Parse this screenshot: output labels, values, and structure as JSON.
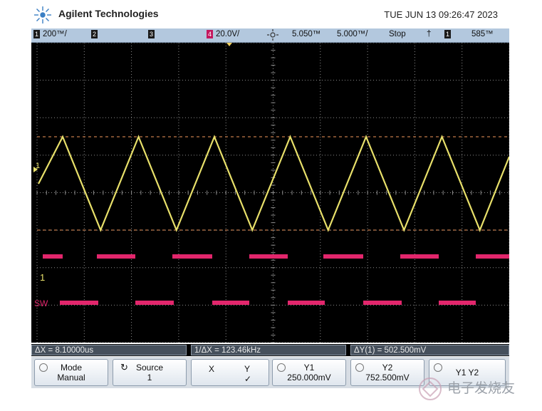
{
  "header": {
    "brand": "Agilent Technologies",
    "datetime": "TUE JUN 13 09:26:47 2023"
  },
  "status_bar": {
    "ch1_num": "1",
    "ch1_scale": "200™/",
    "ch2_num": "2",
    "ch3_num": "3",
    "ch4_num": "4",
    "ch4_scale": "20.0V/",
    "time_offset": "5.050™",
    "time_scale": "5.000™/",
    "run_state": "Stop",
    "trigger_symbol": "†",
    "trigger_ch": "1",
    "trigger_level": "585™"
  },
  "screen": {
    "ch1_label": "1",
    "ch4_label": "1",
    "sw_label": "SW",
    "colors": {
      "ch1": "#e8e06a",
      "ch4": "#e2266c",
      "grid": "#8c8c8c",
      "cursor": "#c47a4a"
    }
  },
  "measurements": {
    "dx": "ΔX = 8.10000us",
    "inv_dx": "1/ΔX = 123.46kHz",
    "dy": "ΔY(1) = 502.500mV"
  },
  "softkeys": {
    "mode_title": "Mode",
    "mode_value": "Manual",
    "source_title": "Source",
    "source_value": "1",
    "x_label": "X",
    "y_label": "Y",
    "y_check": "✓",
    "y1_title": "Y1",
    "y1_value": "250.000mV",
    "y2_title": "Y2",
    "y2_value": "752.500mV",
    "y1y2_title": "Y1 Y2"
  },
  "watermark": {
    "text": "电子发烧友"
  }
}
